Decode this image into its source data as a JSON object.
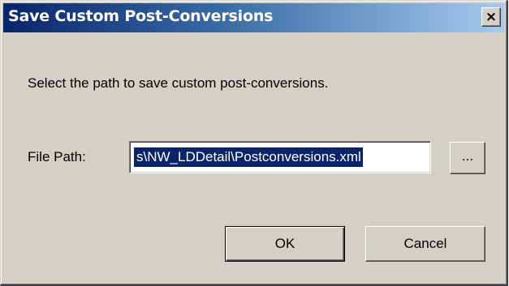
{
  "window": {
    "title": "Save Custom Post-Conversions",
    "close_glyph": "×"
  },
  "prompt": "Select the path to save custom post-conversions.",
  "file_path": {
    "label": "File Path:",
    "value": "s\\NW_LDDetail\\Postconversions.xml",
    "browse_label": "..."
  },
  "buttons": {
    "ok": "OK",
    "cancel": "Cancel"
  },
  "colors": {
    "titlebar_start": "#0a246a",
    "titlebar_end": "#a6caf0",
    "dialog_face": "#d4d0c8",
    "selection": "#0a246a"
  },
  "icons": {
    "close": "close-icon"
  }
}
